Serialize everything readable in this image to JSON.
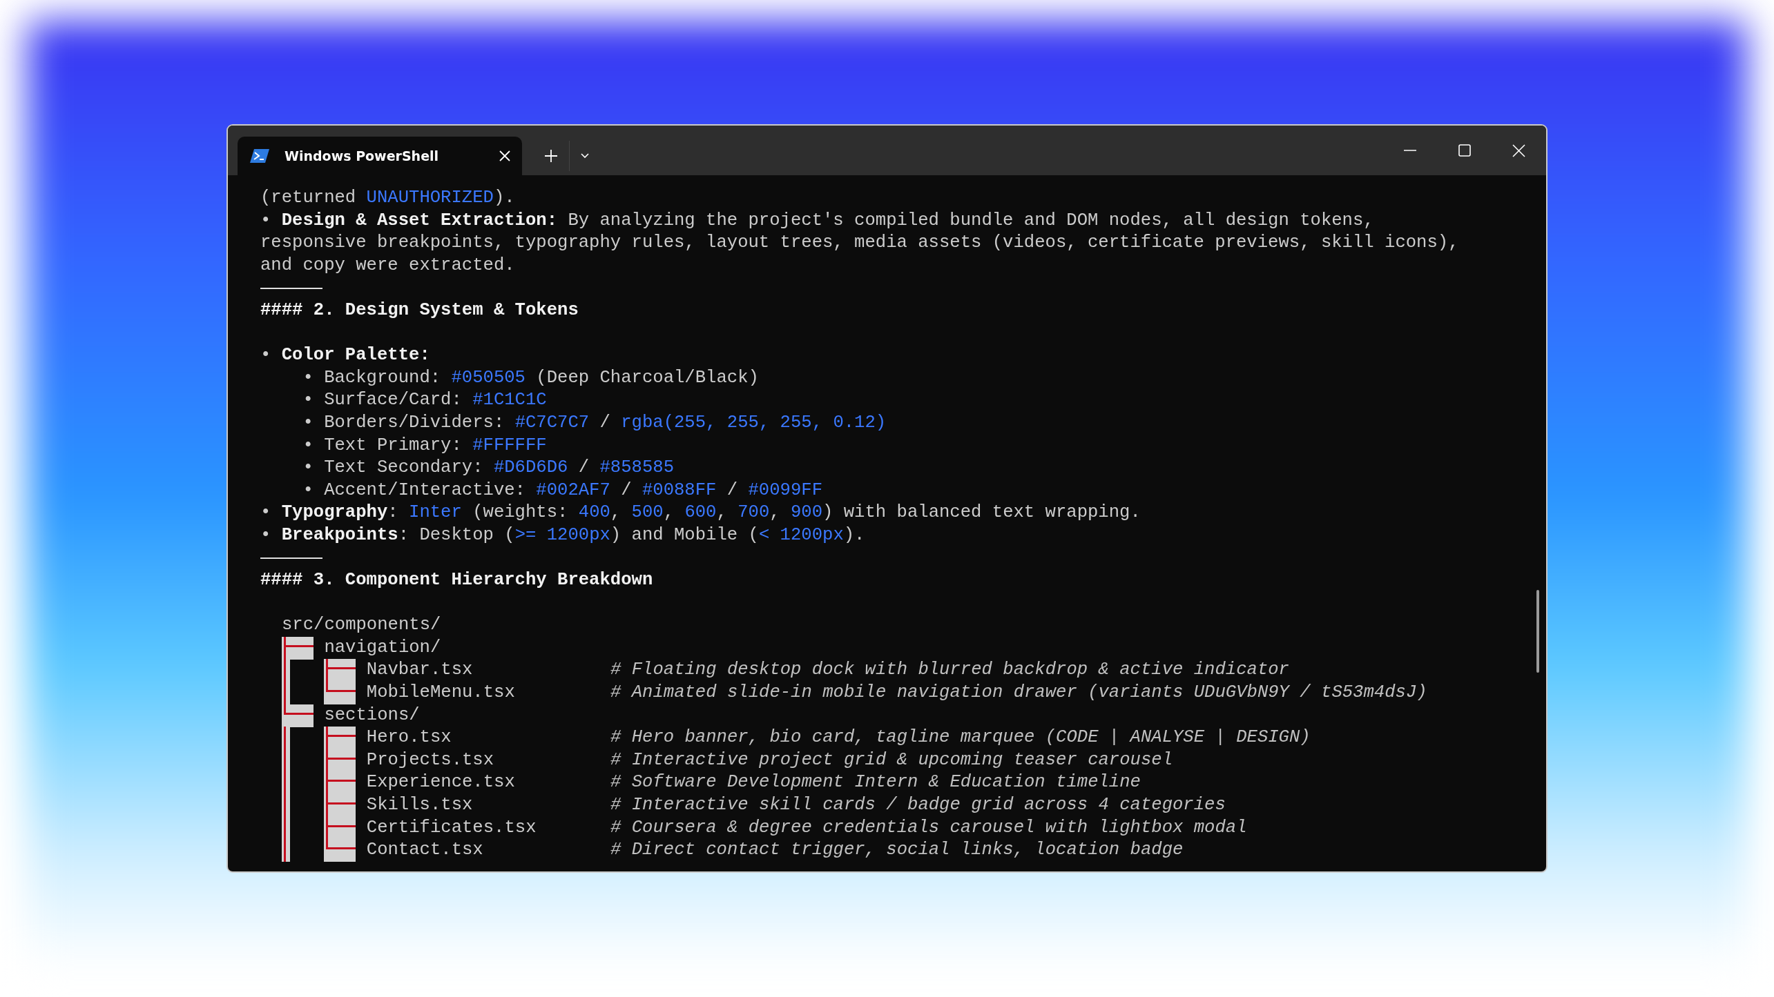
{
  "window": {
    "tabs": [
      {
        "title": "Windows PowerShell",
        "selected": true
      }
    ]
  },
  "terminal": {
    "lines": [
      {
        "kind": "text",
        "segments": [
          {
            "text": "(returned ",
            "kind": "plain"
          },
          {
            "text": "UNAUTHORIZED",
            "kind": "link"
          },
          {
            "text": ").",
            "kind": "plain"
          }
        ]
      },
      {
        "kind": "text",
        "segments": [
          {
            "text": "• ",
            "kind": "plain"
          },
          {
            "text": "Design & Asset Extraction:",
            "kind": "bold"
          },
          {
            "text": " By analyzing the project's compiled bundle and DOM nodes, all design tokens,",
            "kind": "plain"
          }
        ]
      },
      {
        "kind": "text",
        "segments": [
          {
            "text": "responsive breakpoints, typography rules, layout trees, media assets (videos, certificate previews, skill icons),",
            "kind": "plain"
          }
        ]
      },
      {
        "kind": "text",
        "segments": [
          {
            "text": "and copy were extracted.",
            "kind": "plain"
          }
        ]
      },
      {
        "kind": "rule"
      },
      {
        "kind": "text",
        "segments": [
          {
            "text": "#### 2. Design System & Tokens",
            "kind": "bold"
          }
        ]
      },
      {
        "kind": "blank"
      },
      {
        "kind": "text",
        "segments": [
          {
            "text": "• ",
            "kind": "plain"
          },
          {
            "text": "Color Palette:",
            "kind": "bold"
          }
        ]
      },
      {
        "kind": "text",
        "segments": [
          {
            "text": "    • Background: ",
            "kind": "plain"
          },
          {
            "text": "#050505",
            "kind": "link"
          },
          {
            "text": " (Deep Charcoal/Black)",
            "kind": "plain"
          }
        ]
      },
      {
        "kind": "text",
        "segments": [
          {
            "text": "    • Surface/Card: ",
            "kind": "plain"
          },
          {
            "text": "#1C1C1C",
            "kind": "link"
          }
        ]
      },
      {
        "kind": "text",
        "segments": [
          {
            "text": "    • Borders/Dividers: ",
            "kind": "plain"
          },
          {
            "text": "#C7C7C7",
            "kind": "link"
          },
          {
            "text": " / ",
            "kind": "plain"
          },
          {
            "text": "rgba(255, 255, 255, 0.12)",
            "kind": "link"
          }
        ]
      },
      {
        "kind": "text",
        "segments": [
          {
            "text": "    • Text Primary: ",
            "kind": "plain"
          },
          {
            "text": "#FFFFFF",
            "kind": "link"
          }
        ]
      },
      {
        "kind": "text",
        "segments": [
          {
            "text": "    • Text Secondary: ",
            "kind": "plain"
          },
          {
            "text": "#D6D6D6",
            "kind": "link"
          },
          {
            "text": " / ",
            "kind": "plain"
          },
          {
            "text": "#858585",
            "kind": "link"
          }
        ]
      },
      {
        "kind": "text",
        "segments": [
          {
            "text": "    • Accent/Interactive: ",
            "kind": "plain"
          },
          {
            "text": "#002AF7",
            "kind": "link"
          },
          {
            "text": " / ",
            "kind": "plain"
          },
          {
            "text": "#0088FF",
            "kind": "link"
          },
          {
            "text": " / ",
            "kind": "plain"
          },
          {
            "text": "#0099FF",
            "kind": "link"
          }
        ]
      },
      {
        "kind": "text",
        "segments": [
          {
            "text": "• ",
            "kind": "plain"
          },
          {
            "text": "Typography",
            "kind": "bold"
          },
          {
            "text": ": ",
            "kind": "plain"
          },
          {
            "text": "Inter",
            "kind": "link"
          },
          {
            "text": " (weights: ",
            "kind": "plain"
          },
          {
            "text": "400",
            "kind": "link"
          },
          {
            "text": ", ",
            "kind": "plain"
          },
          {
            "text": "500",
            "kind": "link"
          },
          {
            "text": ", ",
            "kind": "plain"
          },
          {
            "text": "600",
            "kind": "link"
          },
          {
            "text": ", ",
            "kind": "plain"
          },
          {
            "text": "700",
            "kind": "link"
          },
          {
            "text": ", ",
            "kind": "plain"
          },
          {
            "text": "900",
            "kind": "link"
          },
          {
            "text": ") with balanced text wrapping.",
            "kind": "plain"
          }
        ]
      },
      {
        "kind": "text",
        "segments": [
          {
            "text": "• ",
            "kind": "plain"
          },
          {
            "text": "Breakpoints",
            "kind": "bold"
          },
          {
            "text": ": Desktop (",
            "kind": "plain"
          },
          {
            "text": ">= 1200px",
            "kind": "link"
          },
          {
            "text": ") and Mobile (",
            "kind": "plain"
          },
          {
            "text": "< 1200px",
            "kind": "link"
          },
          {
            "text": ").",
            "kind": "plain"
          }
        ]
      },
      {
        "kind": "rule"
      },
      {
        "kind": "text",
        "segments": [
          {
            "text": "#### 3. Component Hierarchy Breakdown",
            "kind": "bold"
          }
        ]
      },
      {
        "kind": "blank"
      }
    ],
    "tree": {
      "label": "src/components/",
      "children": [
        {
          "label": "navigation/",
          "children": [
            {
              "label": "Navbar.tsx",
              "comment": "# Floating desktop dock with blurred backdrop & active indicator"
            },
            {
              "label": "MobileMenu.tsx",
              "comment": "# Animated slide-in mobile navigation drawer (variants UDuGVbN9Y / tS53m4dsJ)"
            }
          ]
        },
        {
          "label": "sections/",
          "children": [
            {
              "label": "Hero.tsx",
              "comment": "# Hero banner, bio card, tagline marquee (CODE | ANALYSE | DESIGN)"
            },
            {
              "label": "Projects.tsx",
              "comment": "# Interactive project grid & upcoming teaser carousel"
            },
            {
              "label": "Experience.tsx",
              "comment": "# Software Development Intern & Education timeline"
            },
            {
              "label": "Skills.tsx",
              "comment": "# Interactive skill cards / badge grid across 4 categories"
            },
            {
              "label": "Certificates.tsx",
              "comment": "# Coursera & degree credentials carousel with lightbox modal"
            },
            {
              "label": "Contact.tsx",
              "comment": "# Direct contact trigger, social links, location badge"
            }
          ]
        }
      ]
    }
  }
}
